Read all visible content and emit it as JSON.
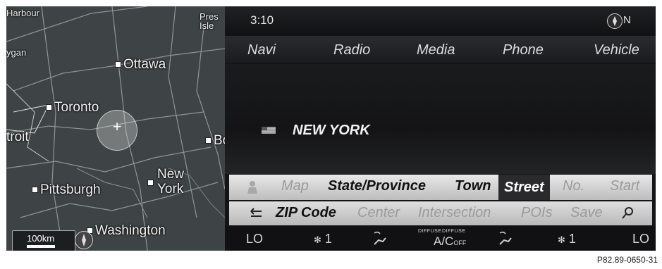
{
  "map": {
    "cities": [
      {
        "name": "Harbour",
        "id": "harbour"
      },
      {
        "name": "Pres Isle",
        "id": "presque-isle"
      },
      {
        "name": "ygan",
        "id": "michigan"
      },
      {
        "name": "Ottawa",
        "id": "ottawa"
      },
      {
        "name": "Toronto",
        "id": "toronto"
      },
      {
        "name": "troit",
        "id": "detroit"
      },
      {
        "name": "Bo",
        "id": "boston"
      },
      {
        "name": "New York",
        "id": "new-york"
      },
      {
        "name": "Pittsburgh",
        "id": "pittsburgh"
      },
      {
        "name": "Washington",
        "id": "washington"
      }
    ],
    "scale_label": "100km",
    "cursor_symbol": "+"
  },
  "status": {
    "time": "3:10",
    "heading": "N"
  },
  "tabs": [
    "Navi",
    "Radio",
    "Media",
    "Phone",
    "Vehicle"
  ],
  "destination": {
    "state": "NEW YORK"
  },
  "address_row1": [
    {
      "label": "Map",
      "state": "disabled"
    },
    {
      "label": "State/Province",
      "state": "enabled"
    },
    {
      "label": "Town",
      "state": "enabled"
    },
    {
      "label": "Street",
      "state": "selected"
    },
    {
      "label": "No.",
      "state": "disabled"
    },
    {
      "label": "Start",
      "state": "disabled"
    }
  ],
  "address_row2": [
    {
      "label": "ZIP Code",
      "state": "enabled"
    },
    {
      "label": "Center",
      "state": "disabled"
    },
    {
      "label": "Intersection",
      "state": "disabled"
    },
    {
      "label": "POIs",
      "state": "disabled"
    },
    {
      "label": "Save",
      "state": "disabled"
    }
  ],
  "climate": {
    "left_temp": "LO",
    "left_fan": "1",
    "diffuse_left": "DIFFUSE",
    "diffuse_right": "DIFFUSE",
    "ac": "A/C",
    "ac_state": "OFF",
    "right_fan": "1",
    "right_temp": "LO"
  },
  "reference": "P82.89-0650-31",
  "colors": {
    "screen_bg": "#151517",
    "button_bar": "#d0d0d0",
    "selected": "#2a2a2c",
    "map_bg": "#3e4445"
  }
}
